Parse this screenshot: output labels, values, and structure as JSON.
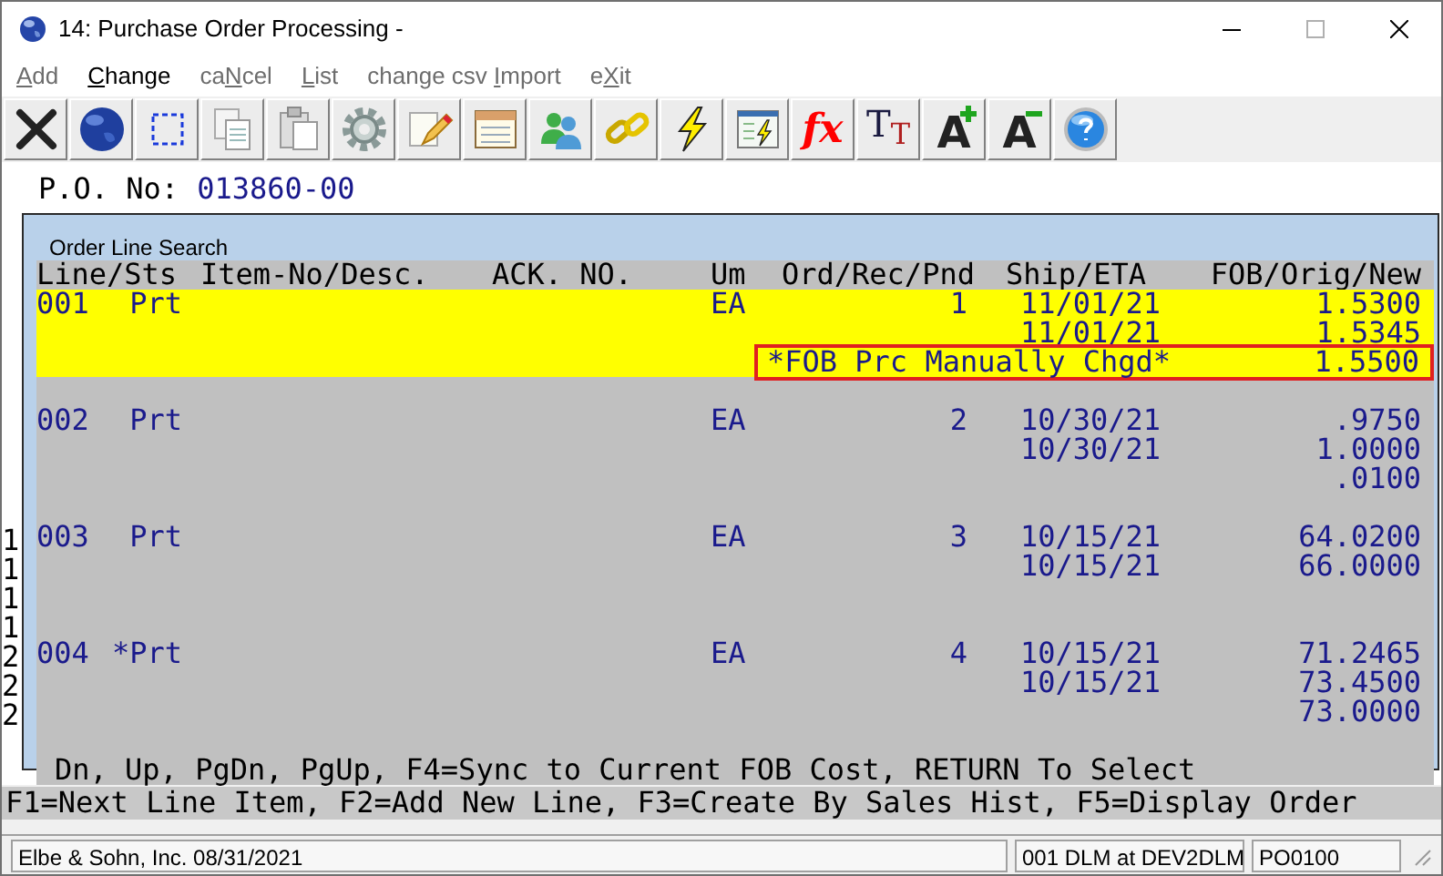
{
  "window": {
    "title": "14: Purchase Order Processing -"
  },
  "menu": [
    {
      "key": "A",
      "after": "dd",
      "disabled": true
    },
    {
      "key": "C",
      "after": "hange",
      "disabled": false
    },
    {
      "before": "ca",
      "key": "N",
      "after": "cel",
      "disabled": true
    },
    {
      "key": "L",
      "after": "ist",
      "disabled": true
    },
    {
      "before": "change csv ",
      "key": "I",
      "after": "mport",
      "disabled": true
    },
    {
      "before": "e",
      "key": "X",
      "after": "it",
      "disabled": true
    }
  ],
  "toolbar": [
    {
      "kind": "icon"
    },
    {
      "kind": "icon"
    },
    {
      "kind": "icon"
    },
    {
      "kind": "icon"
    },
    {
      "kind": "icon"
    },
    {
      "kind": "icon"
    },
    {
      "kind": "icon"
    },
    {
      "kind": "icon"
    },
    {
      "kind": "icon"
    },
    {
      "kind": "icon"
    },
    {
      "kind": "icon"
    },
    {
      "kind": "icon"
    },
    {
      "kind": "formula",
      "text": "fx"
    },
    {
      "kind": "type-size",
      "text": "T",
      "small": "T"
    },
    {
      "kind": "font-grow",
      "text": "A"
    },
    {
      "kind": "font-shrink",
      "text": "A"
    },
    {
      "kind": "icon"
    }
  ],
  "po": {
    "label": "P.O. No:",
    "value": "013860-00"
  },
  "behind_digits": [
    "1",
    "1",
    "1",
    "1",
    "2",
    "2",
    "2"
  ],
  "dialog": {
    "title": "Order Line Search",
    "headers": [
      "Line/Sts",
      "Item-No/Desc.",
      "ACK. NO.",
      "Um",
      "Ord/Rec/Pnd",
      "Ship/ETA",
      "FOB/Orig/New"
    ],
    "rows": [
      {
        "line": "001",
        "sts": "Prt",
        "um": "EA",
        "qty": "1",
        "dates": [
          "11/01/21",
          "11/01/21"
        ],
        "prices": [
          "1.5300",
          "1.5345",
          "1.5500"
        ],
        "note": "*FOB Prc Manually Chgd*",
        "selected": true
      },
      {
        "line": "002",
        "sts": "Prt",
        "um": "EA",
        "qty": "2",
        "dates": [
          "10/30/21",
          "10/30/21"
        ],
        "prices": [
          ".9750",
          "1.0000",
          ".0100"
        ],
        "selected": false
      },
      {
        "line": "003",
        "sts": "Prt",
        "um": "EA",
        "qty": "3",
        "dates": [
          "10/15/21",
          "10/15/21"
        ],
        "prices": [
          "64.0200",
          "66.0000"
        ],
        "selected": false
      },
      {
        "line": "004",
        "sts": "*Prt",
        "um": "EA",
        "qty": "4",
        "dates": [
          "10/15/21",
          "10/15/21"
        ],
        "prices": [
          "71.2465",
          "73.4500",
          "73.0000"
        ],
        "selected": false
      }
    ],
    "footer": "Dn, Up, PgDn, PgUp, F4=Sync to Current FOB Cost, RETURN To Select"
  },
  "function_keys": "F1=Next Line Item, F2=Add New Line, F3=Create By Sales Hist, F5=Display Order",
  "status_bar": [
    "Elbe & Sohn, Inc. 08/31/2021",
    "001 DLM at DEV2DLM",
    "PO0100"
  ]
}
